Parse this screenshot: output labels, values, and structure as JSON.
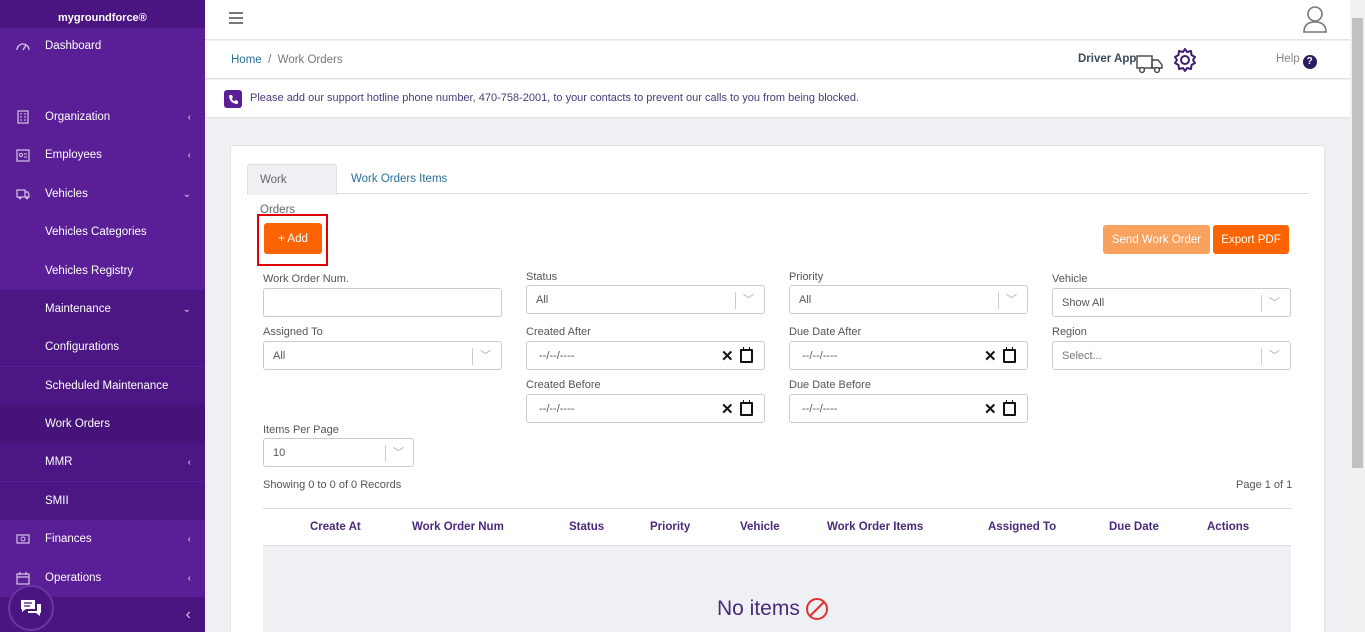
{
  "brand": "mygroundforce®",
  "sidebar": {
    "items": [
      {
        "label": "Dashboard",
        "chev": ""
      },
      {
        "label": "Organization",
        "chev": "‹"
      },
      {
        "label": "Employees",
        "chev": "‹"
      },
      {
        "label": "Vehicles",
        "chev": "⌄"
      },
      {
        "label": "Vehicles Categories",
        "chev": ""
      },
      {
        "label": "Vehicles Registry",
        "chev": ""
      },
      {
        "label": "Maintenance",
        "chev": "⌄"
      },
      {
        "label": "Configurations",
        "chev": ""
      },
      {
        "label": "Scheduled Maintenance",
        "chev": ""
      },
      {
        "label": "Work Orders",
        "chev": ""
      },
      {
        "label": "MMR",
        "chev": "‹"
      },
      {
        "label": "SMII",
        "chev": ""
      },
      {
        "label": "Finances",
        "chev": "‹"
      },
      {
        "label": "Operations",
        "chev": "‹"
      }
    ],
    "collapse": "‹"
  },
  "breadcrumb": {
    "home": "Home",
    "sep": "/",
    "current": "Work Orders"
  },
  "header": {
    "driver_app": "Driver App",
    "help": "Help",
    "help_icon": "?"
  },
  "notice": "Please add our support hotline phone number, 470-758-2001, to your contacts to prevent our calls to you from being blocked.",
  "tabs": {
    "work_orders": "Work Orders",
    "work_orders_items": "Work Orders Items"
  },
  "buttons": {
    "add": "+ Add",
    "send": "Send Work Order",
    "export": "Export PDF"
  },
  "filters": {
    "work_order_num": {
      "label": "Work Order Num.",
      "value": ""
    },
    "status": {
      "label": "Status",
      "value": "All"
    },
    "priority": {
      "label": "Priority",
      "value": "All"
    },
    "vehicle": {
      "label": "Vehicle",
      "value": "Show All"
    },
    "assigned_to": {
      "label": "Assigned To",
      "value": "All"
    },
    "created_after": {
      "label": "Created After",
      "value": "--/--/----"
    },
    "due_date_after": {
      "label": "Due Date After",
      "value": "--/--/----"
    },
    "region": {
      "label": "Region",
      "placeholder": "Select..."
    },
    "created_before": {
      "label": "Created Before",
      "value": "--/--/----"
    },
    "due_date_before": {
      "label": "Due Date Before",
      "value": "--/--/----"
    },
    "items_per_page": {
      "label": "Items Per Page",
      "value": "10"
    }
  },
  "records_text": "Showing 0 to 0 of 0 Records",
  "page_text": "Page 1 of 1",
  "table": {
    "columns": [
      "Create At",
      "Work Order Num",
      "Status",
      "Priority",
      "Vehicle",
      "Work Order Items",
      "Assigned To",
      "Due Date",
      "Actions"
    ],
    "empty": "No items"
  },
  "colors": {
    "sidebar": "#5a1e96",
    "accent": "#fb6400",
    "accent_light": "#f9a25f",
    "highlight": "#e00000"
  }
}
